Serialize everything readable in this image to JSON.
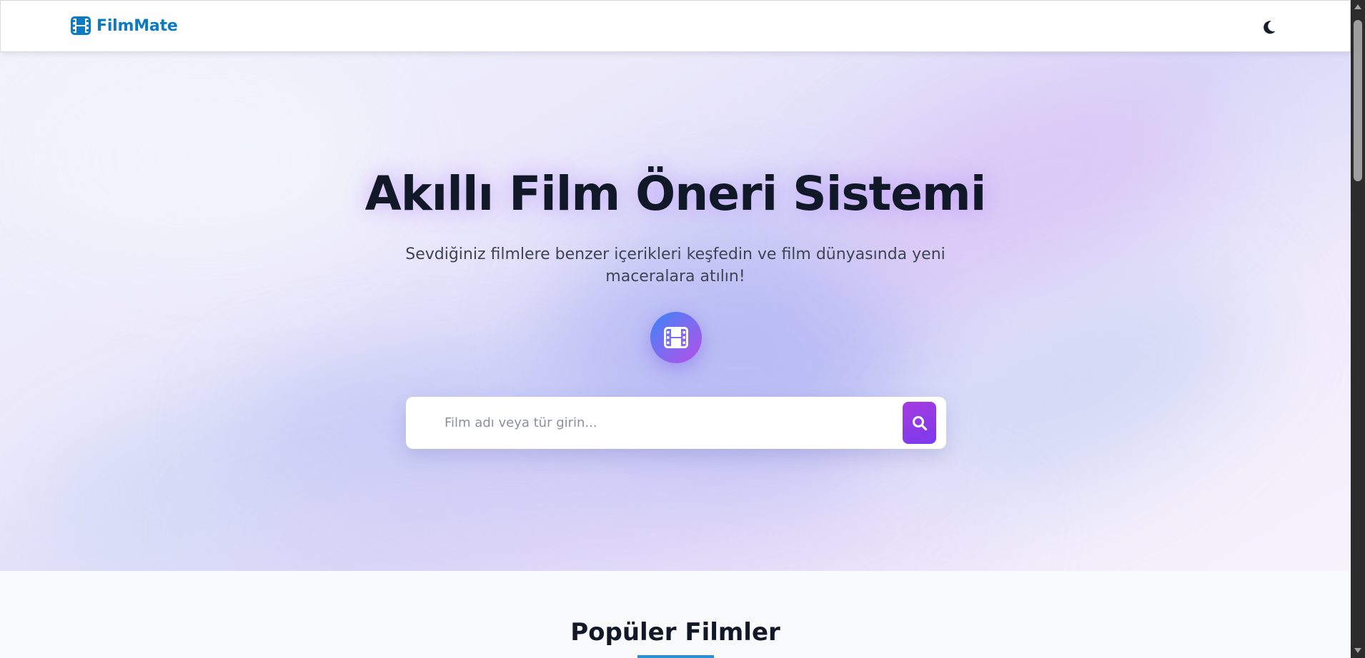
{
  "header": {
    "brand": "FilmMate",
    "brand_icon": "film-icon",
    "theme_icon": "moon-icon",
    "brand_color": "#0b7bc4"
  },
  "hero": {
    "title": "Akıllı Film Öneri Sistemi",
    "subtitle": "Sevdiğiniz filmlere benzer içerikleri keşfedin ve film dünyasında yeni maceralara atılın!",
    "badge_icon": "film-icon",
    "search": {
      "placeholder": "Film adı veya tür girin...",
      "value": "",
      "button_icon": "search-icon"
    },
    "accent_color": "#7c3aed"
  },
  "popular": {
    "title": "Popüler Filmler",
    "underline_color": "#2b8fd6"
  }
}
